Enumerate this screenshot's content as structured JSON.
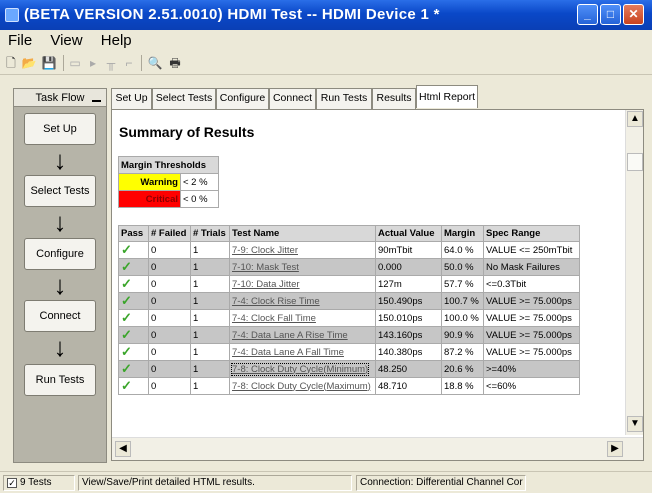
{
  "window": {
    "title": "(BETA VERSION 2.51.0010) HDMI Test -- HDMI Device 1 *"
  },
  "menu": [
    "File",
    "View",
    "Help"
  ],
  "taskflow": {
    "title": "Task Flow",
    "steps": [
      "Set Up",
      "Select Tests",
      "Configure",
      "Connect",
      "Run Tests"
    ]
  },
  "tabs": [
    "Set Up",
    "Select Tests",
    "Configure",
    "Connect",
    "Run Tests",
    "Results",
    "Html Report"
  ],
  "report": {
    "heading": "Summary of Results",
    "thresholds": {
      "title": "Margin Thresholds",
      "warning_label": "Warning",
      "warning_value": "< 2 %",
      "critical_label": "Critical",
      "critical_value": "< 0 %"
    },
    "columns": [
      "Pass",
      "# Failed",
      "# Trials",
      "Test Name",
      "Actual Value",
      "Margin",
      "Spec Range"
    ],
    "rows": [
      {
        "failed": "0",
        "trials": "1",
        "name": "7-9: Clock Jitter",
        "actual": "90mTbit",
        "margin": "64.0 %",
        "spec": "VALUE <= 250mTbit"
      },
      {
        "failed": "0",
        "trials": "1",
        "name": "7-10: Mask Test",
        "actual": "0.000",
        "margin": "50.0 %",
        "spec": "No Mask Failures"
      },
      {
        "failed": "0",
        "trials": "1",
        "name": "7-10: Data Jitter",
        "actual": "127m",
        "margin": "57.7 %",
        "spec": "<=0.3Tbit"
      },
      {
        "failed": "0",
        "trials": "1",
        "name": "7-4: Clock Rise Time",
        "actual": "150.490ps",
        "margin": "100.7 %",
        "spec": "VALUE >= 75.000ps"
      },
      {
        "failed": "0",
        "trials": "1",
        "name": "7-4: Clock Fall Time",
        "actual": "150.010ps",
        "margin": "100.0 %",
        "spec": "VALUE >= 75.000ps"
      },
      {
        "failed": "0",
        "trials": "1",
        "name": "7-4: Data Lane A Rise Time",
        "actual": "143.160ps",
        "margin": "90.9 %",
        "spec": "VALUE >= 75.000ps"
      },
      {
        "failed": "0",
        "trials": "1",
        "name": "7-4: Data Lane A Fall Time",
        "actual": "140.380ps",
        "margin": "87.2 %",
        "spec": "VALUE >= 75.000ps"
      },
      {
        "failed": "0",
        "trials": "1",
        "name": "7-8: Clock Duty Cycle(Minimum)",
        "actual": "48.250",
        "margin": "20.6 %",
        "spec": ">=40%"
      },
      {
        "failed": "0",
        "trials": "1",
        "name": "7-8: Clock Duty Cycle(Maximum)",
        "actual": "48.710",
        "margin": "18.8 %",
        "spec": "<=60%"
      }
    ]
  },
  "status": {
    "tests": "9 Tests",
    "hint": "View/Save/Print detailed HTML results.",
    "connection": "Connection: Differential Channel Cor"
  },
  "colors": {
    "titlebar": "#0a48c8",
    "warning": "#ffff00",
    "critical": "#ff0000",
    "pass_check": "#3aa52a"
  }
}
